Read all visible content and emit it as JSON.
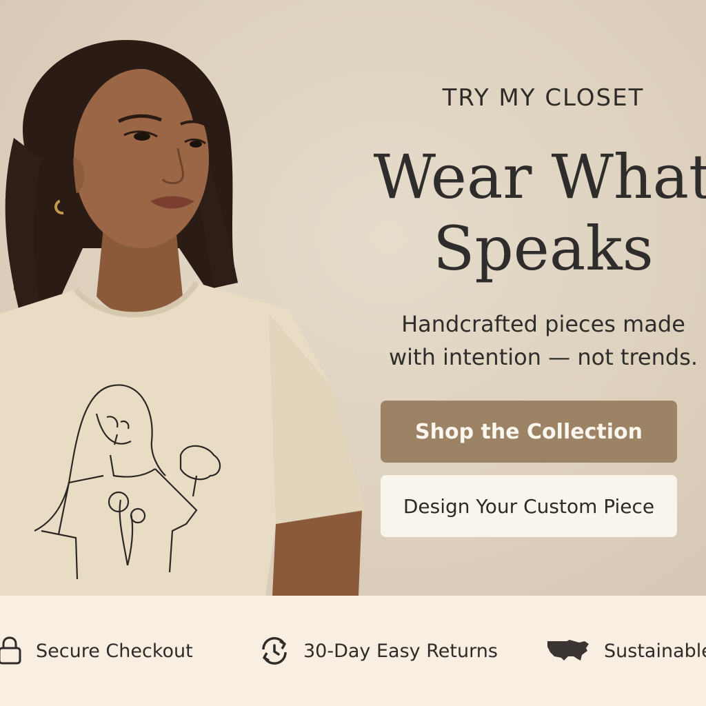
{
  "hero": {
    "eyebrow": "TRY MY CLOSET",
    "title_line1": "Wear What",
    "title_line2": "Speaks",
    "subtitle_line1": "Handcrafted pieces made",
    "subtitle_line2": "with intention — not trends.",
    "primary_cta": "Shop the Collection",
    "secondary_cta": "Design Your Custom Piece"
  },
  "trust_bar": {
    "items": [
      {
        "label": "Secure Checkout",
        "icon": "lock-icon"
      },
      {
        "label": "30-Day Easy Returns",
        "icon": "returns-clock-icon"
      },
      {
        "label": "Sustainable",
        "icon": "usa-map-icon"
      }
    ]
  },
  "colors": {
    "background": "#ddd1be",
    "primary_button": "#9c8365",
    "secondary_button": "#faf5ec",
    "text": "#2f2d2b",
    "trust_bar": "#f8efe2"
  }
}
